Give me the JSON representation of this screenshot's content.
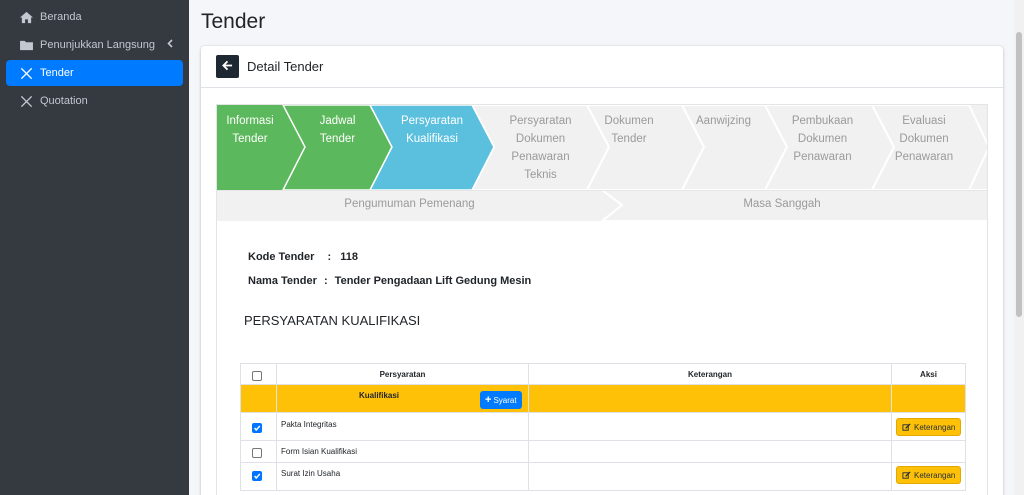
{
  "sidebar": {
    "items": [
      {
        "label": "Beranda",
        "icon": "home-icon",
        "active": false
      },
      {
        "label": "Penunjukkan Langsung",
        "icon": "folder-icon",
        "active": false,
        "has_submenu": true
      },
      {
        "label": "Tender",
        "icon": "tools-icon",
        "active": true
      },
      {
        "label": "Quotation",
        "icon": "tools-icon",
        "active": false
      }
    ]
  },
  "header": {
    "page_title": "Tender"
  },
  "card": {
    "title": "Detail Tender",
    "back_icon": "arrow-left-icon"
  },
  "steps": {
    "items": [
      {
        "lines": [
          "Informasi",
          "Tender"
        ],
        "state": "done"
      },
      {
        "lines": [
          "Jadwal",
          "Tender"
        ],
        "state": "done"
      },
      {
        "lines": [
          "Persyaratan",
          "Kualifikasi"
        ],
        "state": "active"
      },
      {
        "lines": [
          "Persyaratan",
          "Dokumen",
          "Penawaran",
          "Teknis"
        ],
        "state": "pending"
      },
      {
        "lines": [
          "Dokumen",
          "Tender"
        ],
        "state": "pending"
      },
      {
        "lines": [
          "Aanwijzing"
        ],
        "state": "pending"
      },
      {
        "lines": [
          "Pembukaan",
          "Dokumen",
          "Penawaran"
        ],
        "state": "pending"
      },
      {
        "lines": [
          "Evaluasi",
          "Dokumen",
          "Penawaran"
        ],
        "state": "pending"
      }
    ],
    "row2": [
      {
        "label": "Pengumuman Pemenang"
      },
      {
        "label": "Masa Sanggah"
      }
    ],
    "colors": {
      "done": "#5cb85c",
      "active": "#5bc0de",
      "pending": "#f1f1f1"
    }
  },
  "info": {
    "kode_label": "Kode Tender",
    "kode_value": "118",
    "nama_label": "Nama Tender",
    "nama_value": "Tender Pengadaan Lift Gedung Mesin",
    "separator": ":"
  },
  "section": {
    "title": "PERSYARATAN KUALIFIKASI"
  },
  "table": {
    "headers": {
      "persyaratan": "Persyaratan",
      "keterangan": "Keterangan",
      "aksi": "Aksi"
    },
    "group": {
      "label": "Kualifikasi",
      "add_button": "Syarat",
      "color": "#ffc107"
    },
    "rows": [
      {
        "label": "Pakta Integritas",
        "checked": true,
        "action": "Keterangan"
      },
      {
        "label": "Form Isian Kualifikasi",
        "checked": false,
        "action": ""
      },
      {
        "label": "Surat Izin Usaha",
        "checked": true,
        "action": "Keterangan"
      }
    ]
  }
}
